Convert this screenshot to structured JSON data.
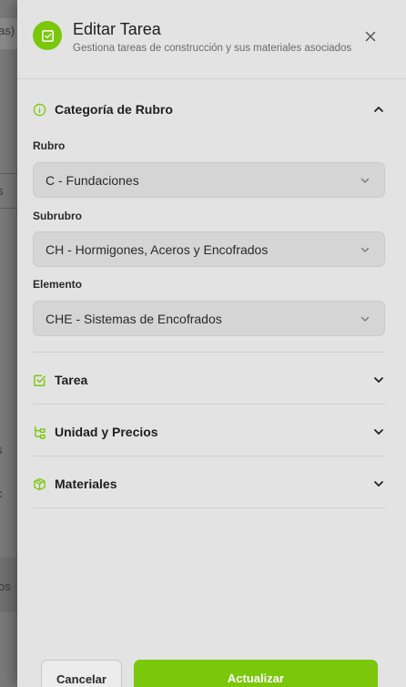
{
  "backdrop": {
    "fragments": [
      "as)",
      "s",
      "s",
      "c",
      "os"
    ]
  },
  "header": {
    "title": "Editar Tarea",
    "subtitle": "Gestiona tareas de construcción y sus materiales asociados",
    "icon": "edit-square-icon",
    "close_icon": "close-icon"
  },
  "sections": {
    "category": {
      "label": "Categoría de Rubro",
      "icon": "info-circle-icon",
      "expanded": true,
      "fields": {
        "rubro": {
          "label": "Rubro",
          "value": "C - Fundaciones"
        },
        "subrubro": {
          "label": "Subrubro",
          "value": "CH - Hormigones, Aceros y Encofrados"
        },
        "elemento": {
          "label": "Elemento",
          "value": "CHE - Sistemas de Encofrados"
        }
      }
    },
    "tarea": {
      "label": "Tarea",
      "icon": "checkbox-icon",
      "expanded": false
    },
    "unidad": {
      "label": "Unidad y Precios",
      "icon": "tree-icon",
      "expanded": false
    },
    "materiales": {
      "label": "Materiales",
      "icon": "package-icon",
      "expanded": false
    }
  },
  "footer": {
    "cancel_label": "Cancelar",
    "submit_label": "Actualizar"
  },
  "colors": {
    "accent": "#7ac70c",
    "panel_bg": "#e3e3e3",
    "select_bg": "#d5d5d5"
  }
}
